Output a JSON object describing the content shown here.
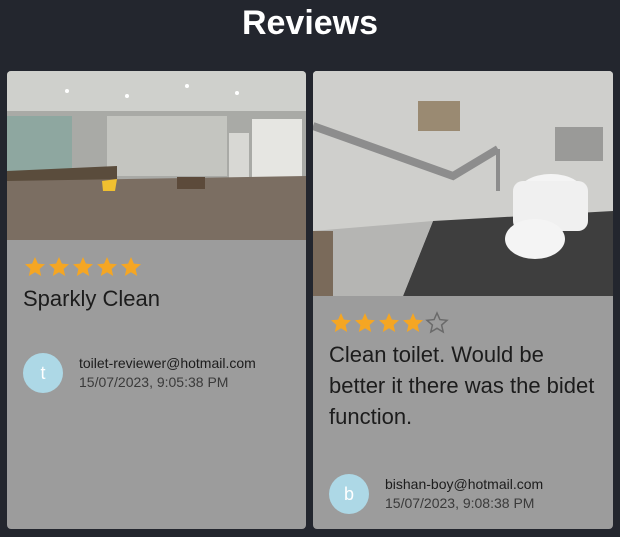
{
  "page": {
    "title": "Reviews"
  },
  "reviews": [
    {
      "rating": 5,
      "max_rating": 5,
      "text": "Sparkly Clean",
      "author_initial": "t",
      "author_email": "toilet-reviewer@hotmail.com",
      "timestamp": "15/07/2023, 9:05:38 PM",
      "photo": "public-restroom-photo"
    },
    {
      "rating": 4,
      "max_rating": 5,
      "text": "Clean toilet. Would be better it there was the bidet function.",
      "author_initial": "b",
      "author_email": "bishan-boy@hotmail.com",
      "timestamp": "15/07/2023, 9:08:38 PM",
      "photo": "accessible-toilet-photo"
    }
  ],
  "colors": {
    "background": "#23262e",
    "card": "#9c9c9c",
    "star_filled": "#f5a623",
    "avatar": "#add8e6"
  }
}
